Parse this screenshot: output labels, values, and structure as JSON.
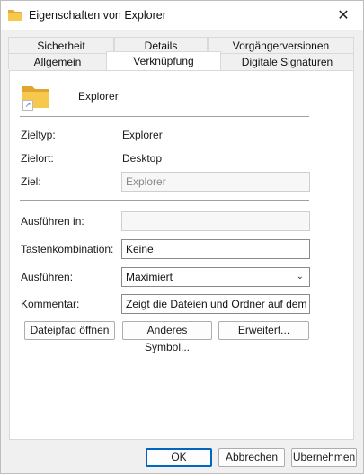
{
  "window": {
    "title": "Eigenschaften von Explorer",
    "close_glyph": "✕"
  },
  "tabs": {
    "row1": [
      "Sicherheit",
      "Details",
      "Vorgängerversionen"
    ],
    "row2": [
      "Allgemein",
      "Verknüpfung",
      "Digitale Signaturen"
    ],
    "active": "Verknüpfung"
  },
  "shortcut": {
    "name": "Explorer",
    "fields": {
      "zieltyp_label": "Zieltyp:",
      "zieltyp_value": "Explorer",
      "zielort_label": "Zielort:",
      "zielort_value": "Desktop",
      "ziel_label": "Ziel:",
      "ziel_value": "Explorer",
      "ausfuehren_in_label": "Ausführen in:",
      "ausfuehren_in_value": "",
      "tastenkombination_label": "Tastenkombination:",
      "tastenkombination_value": "Keine",
      "ausfuehren_label": "Ausführen:",
      "ausfuehren_value": "Maximiert",
      "kommentar_label": "Kommentar:",
      "kommentar_value": "Zeigt die Dateien und Ordner auf dem Comp"
    },
    "buttons": {
      "dateipfad": "Dateipfad öffnen",
      "symbol": "Anderes Symbol...",
      "erweitert": "Erweitert..."
    }
  },
  "footer": {
    "ok": "OK",
    "abbrechen": "Abbrechen",
    "uebernehmen": "Übernehmen"
  },
  "colors": {
    "accent": "#0067c0",
    "folder": "#f4c542"
  }
}
